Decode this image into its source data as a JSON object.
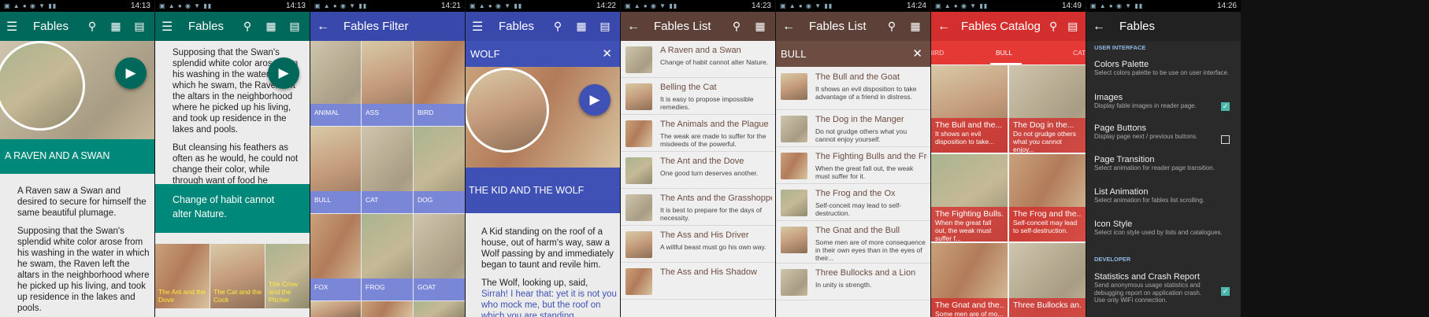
{
  "status_times": [
    "14:13",
    "14:13",
    "14:21",
    "14:22",
    "14:23",
    "14:24",
    "14:49",
    "14:26"
  ],
  "panel1": {
    "title": "Fables",
    "fable_title": "A RAVEN AND A SWAN",
    "body": [
      "A Raven saw a Swan and desired to secure for himself the same beautiful plumage.",
      "Supposing that the Swan's splendid white color arose from his washing in the water in which he swam, the Raven left the altars in the neighborhood where he picked up his living, and took up residence in the lakes and pools."
    ],
    "colors": {
      "bar": "#00695c",
      "band": "#00897b"
    }
  },
  "panel2": {
    "title": "Fables",
    "body": [
      "Supposing that the Swan's splendid white color arose from his washing in the water in which he swam, the Raven left the altars in the neighborhood where he picked up his living, and took up residence in the lakes and pools.",
      "But cleansing his feathers as often as he would, he could not change their color, while through want of food he perished."
    ],
    "moral": "Change of habit cannot alter Nature.",
    "related": [
      "The Ant and the Dove",
      "The Cat and the Cock",
      "The Crow and the Pitcher"
    ]
  },
  "panel3": {
    "title": "Fables Filter",
    "categories": [
      "ANIMAL",
      "ASS",
      "BIRD",
      "BULL",
      "CAT",
      "DOG",
      "FOX",
      "FROG",
      "GOAT"
    ],
    "colors": {
      "bar": "#3949ab",
      "label": "#7986cb"
    }
  },
  "panel4": {
    "title": "Fables",
    "search": "WOLF",
    "fable_title": "THE KID AND THE WOLF",
    "body": [
      "A Kid standing on the roof of a house, out of harm's way, saw a Wolf passing by and immediately began to taunt and revile him."
    ],
    "para2_start": "The Wolf, looking up, said, ",
    "para2_link": "Sirrah! I hear that: yet it is not you who mock me, but the roof on which you are standing.",
    "colors": {
      "bar": "#3949ab",
      "band": "#3f51b5",
      "link": "#3f51b5"
    }
  },
  "panel5": {
    "title": "Fables List",
    "items": [
      {
        "t": "A Raven and a Swan",
        "d": "Change of habit cannot alter Nature."
      },
      {
        "t": "Belling the Cat",
        "d": "It is easy to propose impossible remedies."
      },
      {
        "t": "The Animals and the Plague",
        "d": "The weak are made to suffer for the misdeeds of the powerful."
      },
      {
        "t": "The Ant and the Dove",
        "d": "One good turn deserves another."
      },
      {
        "t": "The Ants and the Grasshopper",
        "d": "It is best to prepare for the days of necessity."
      },
      {
        "t": "The Ass and His Driver",
        "d": "A willful beast must go his own way."
      },
      {
        "t": "The Ass and His Shadow",
        "d": ""
      }
    ],
    "colors": {
      "bar": "#5d4037",
      "accent": "#6d4c41"
    }
  },
  "panel6": {
    "title": "Fables List",
    "search": "BULL",
    "items": [
      {
        "t": "The Bull and the Goat",
        "d": "It shows an evil disposition to take advantage of a friend in distress."
      },
      {
        "t": "The Dog in the Manger",
        "d": "Do not grudge others what you cannot enjoy yourself."
      },
      {
        "t": "The Fighting Bulls and the Frog",
        "d": "When the great fall out, the weak must suffer for it."
      },
      {
        "t": "The Frog and the Ox",
        "d": "Self-conceit may lead to self-destruction."
      },
      {
        "t": "The Gnat and the Bull",
        "d": "Some men are of more consequence in their own eyes than in the eyes of their..."
      },
      {
        "t": "Three Bullocks and a Lion",
        "d": "In unity is strength."
      }
    ]
  },
  "panel7": {
    "title": "Fables Catalog",
    "tabs": [
      "BIRD",
      "BULL",
      "CAT"
    ],
    "active_tab": "BULL",
    "cards": [
      {
        "a": "The Bull and the...",
        "b": "It shows an evil disposition to take..."
      },
      {
        "a": "The Dog in the...",
        "b": "Do not grudge others what you cannot enjoy..."
      },
      {
        "a": "The Fighting Bulls...",
        "b": "When the great fall out, the weak must suffer f..."
      },
      {
        "a": "The Frog and the...",
        "b": "Self-conceit may lead to self-destruction."
      },
      {
        "a": "The Gnat and the...",
        "b": "Some men are of mo..."
      },
      {
        "a": "Three Bullocks an...",
        "b": ""
      }
    ],
    "colors": {
      "bar": "#d32f2f",
      "tab": "#e53935"
    }
  },
  "panel8": {
    "title": "Fables",
    "section_ui": "USER INTERFACE",
    "items": [
      {
        "t": "Colors Palette",
        "d": "Select colors palette to be use on user interface."
      },
      {
        "t": "Images",
        "d": "Display fable images in reader page."
      },
      {
        "t": "Page Buttons",
        "d": "Display page next / previous buttons."
      },
      {
        "t": "Page Transition",
        "d": "Select animation for reader page transition."
      },
      {
        "t": "List Animation",
        "d": "Select animation for fables list scrolling."
      },
      {
        "t": "Icon Style",
        "d": "Select icon style used by lists and catalogues."
      }
    ],
    "section_dev": "DEVELOPER",
    "dev_item": {
      "t": "Statistics and Crash Report",
      "d": "Send anonymous usage statistics and debugging report on application crash. Use only WiFi connection."
    },
    "checked": {
      "images": true,
      "page_buttons": false,
      "stats": true
    },
    "colors": {
      "bg": "#2a2a2a",
      "bar": "#212121"
    }
  }
}
